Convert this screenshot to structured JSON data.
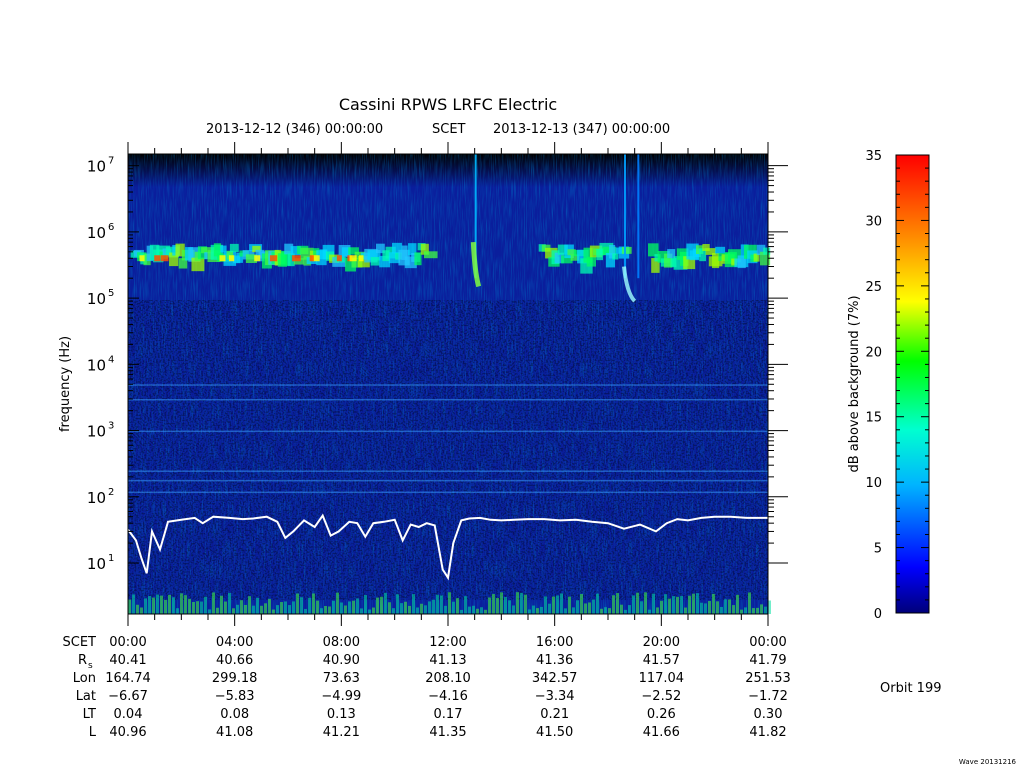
{
  "title": "Cassini RPWS LRFC Electric",
  "subtitle": {
    "start": "2013-12-12 (346) 00:00:00",
    "mid": "SCET",
    "end": "2013-12-13 (347) 00:00:00"
  },
  "footer": "Wave 20131216",
  "orbit": "Orbit 199",
  "colors": {
    "background_dark": "#000000",
    "spectrogram_base": "#0a1e9c",
    "fce_line": "#ffffff",
    "colorbar_stops": [
      "#00007a",
      "#0000ff",
      "#00b4ff",
      "#00ffd0",
      "#00ff00",
      "#ffff00",
      "#ff8c00",
      "#ff0000"
    ]
  },
  "chart_data": {
    "type": "heatmap",
    "title": "Cassini RPWS LRFC Electric",
    "ylabel": "frequency (Hz)",
    "yscale": "log",
    "ylim": [
      1.7,
      15000000
    ],
    "y_ticks": [
      {
        "base": "10",
        "exp": "1",
        "value": 10
      },
      {
        "base": "10",
        "exp": "2",
        "value": 100
      },
      {
        "base": "10",
        "exp": "3",
        "value": 1000
      },
      {
        "base": "10",
        "exp": "4",
        "value": 10000
      },
      {
        "base": "10",
        "exp": "5",
        "value": 100000
      },
      {
        "base": "10",
        "exp": "6",
        "value": 1000000
      },
      {
        "base": "10",
        "exp": "7",
        "value": 10000000
      }
    ],
    "xlim_hours": [
      0,
      24
    ],
    "x_ticks": [
      "00:00",
      "04:00",
      "08:00",
      "12:00",
      "16:00",
      "20:00",
      "00:00"
    ],
    "x_tick_hours": [
      0,
      4,
      8,
      12,
      16,
      20,
      24
    ],
    "colorbar": {
      "label": "dB above background (7%)",
      "range": [
        0,
        35
      ],
      "ticks": [
        "0",
        "5",
        "10",
        "15",
        "20",
        "25",
        "30",
        "35"
      ]
    },
    "ephemeris": {
      "rows": [
        {
          "label": "SCET",
          "sub": "",
          "values": [
            "00:00",
            "04:00",
            "08:00",
            "12:00",
            "16:00",
            "20:00",
            "00:00"
          ]
        },
        {
          "label": "R",
          "sub": "s",
          "values": [
            "40.41",
            "40.66",
            "40.90",
            "41.13",
            "41.36",
            "41.57",
            "41.79"
          ]
        },
        {
          "label": "Lon",
          "sub": "",
          "values": [
            "164.74",
            "299.18",
            "73.63",
            "208.10",
            "342.57",
            "117.04",
            "251.53"
          ]
        },
        {
          "label": "Lat",
          "sub": "",
          "values": [
            "−6.67",
            "−5.83",
            "−4.99",
            "−4.16",
            "−3.34",
            "−2.52",
            "−1.72"
          ]
        },
        {
          "label": "LT",
          "sub": "",
          "values": [
            "0.04",
            "0.08",
            "0.13",
            "0.17",
            "0.21",
            "0.26",
            "0.30"
          ]
        },
        {
          "label": "L",
          "sub": "",
          "values": [
            "40.96",
            "41.08",
            "41.21",
            "41.35",
            "41.50",
            "41.66",
            "41.82"
          ]
        }
      ]
    },
    "fce_line": {
      "hours": [
        0,
        0.3,
        0.5,
        0.7,
        0.9,
        1.2,
        1.5,
        2.0,
        2.5,
        2.8,
        3.2,
        3.8,
        4.3,
        4.7,
        5.2,
        5.6,
        5.9,
        6.2,
        6.6,
        7.0,
        7.3,
        7.6,
        7.9,
        8.3,
        8.6,
        8.9,
        9.2,
        9.6,
        10.0,
        10.3,
        10.6,
        10.9,
        11.2,
        11.5,
        11.8,
        12.0,
        12.2,
        12.5,
        12.8,
        13.2,
        13.6,
        14.0,
        14.5,
        15.0,
        15.6,
        16.2,
        16.8,
        17.4,
        18.0,
        18.6,
        19.2,
        19.8,
        20.2,
        20.6,
        21.0,
        21.5,
        22.0,
        22.6,
        23.2,
        24.0
      ],
      "values": [
        32,
        22,
        12,
        7,
        30,
        16,
        42,
        45,
        48,
        40,
        50,
        48,
        46,
        47,
        50,
        42,
        24,
        30,
        44,
        35,
        52,
        26,
        30,
        42,
        40,
        25,
        40,
        42,
        45,
        22,
        38,
        35,
        40,
        37,
        8,
        6,
        20,
        44,
        47,
        48,
        45,
        44,
        45,
        46,
        46,
        44,
        45,
        42,
        40,
        33,
        38,
        30,
        40,
        46,
        44,
        48,
        50,
        50,
        48,
        48
      ]
    }
  }
}
